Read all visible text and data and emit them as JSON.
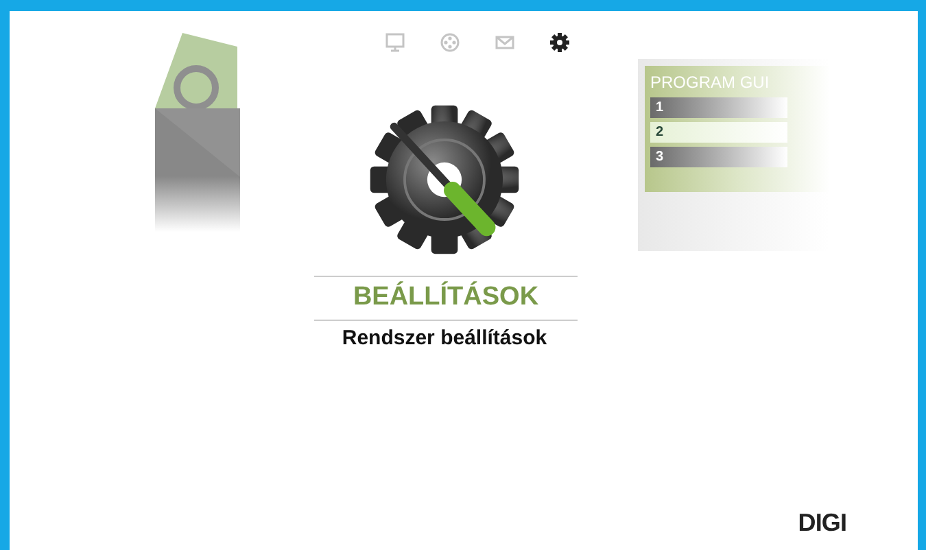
{
  "nav": [
    {
      "kind": "tv",
      "selected": false
    },
    {
      "kind": "film",
      "selected": false
    },
    {
      "kind": "mail",
      "selected": false
    },
    {
      "kind": "settings",
      "selected": true
    }
  ],
  "side_left": {
    "kind": "mail"
  },
  "side_right": {
    "kind": "guide",
    "title": "PROGRAM GUI",
    "rows": [
      {
        "label": "1",
        "selected": false
      },
      {
        "label": "2",
        "selected": true
      },
      {
        "label": "3",
        "selected": false
      }
    ]
  },
  "title": "BEÁLLÍTÁSOK",
  "subtitle": "Rendszer beállítások",
  "logo": "DIGI"
}
